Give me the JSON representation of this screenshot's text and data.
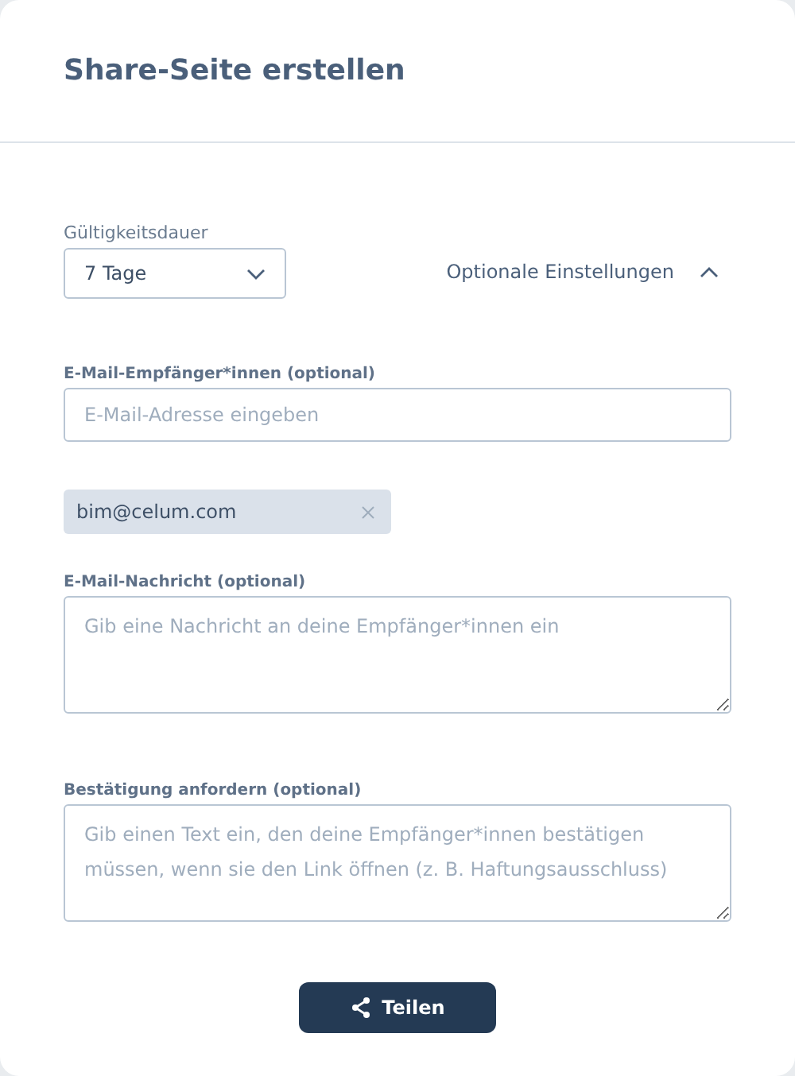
{
  "dialog": {
    "title": "Share-Seite erstellen"
  },
  "validity": {
    "label": "Gültigkeitsdauer",
    "value": "7 Tage"
  },
  "optional_settings": {
    "label": "Optionale Einstellungen",
    "expanded": true
  },
  "recipients": {
    "label": "E-Mail-Empfänger*innen (optional)",
    "placeholder": "E-Mail-Adresse eingeben",
    "chips": [
      {
        "label": "bim@celum.com"
      }
    ]
  },
  "message": {
    "label": "E-Mail-Nachricht (optional)",
    "placeholder": "Gib eine Nachricht an deine Empfänger*innen ein"
  },
  "confirmation": {
    "label": "Bestätigung anfordern (optional)",
    "placeholder": "Gib einen Text ein, den deine Empfänger*innen bestätigen müssen, wenn sie den Link öffnen (z. B. Haftungsausschluss)"
  },
  "share_button": {
    "label": "Teilen"
  }
}
